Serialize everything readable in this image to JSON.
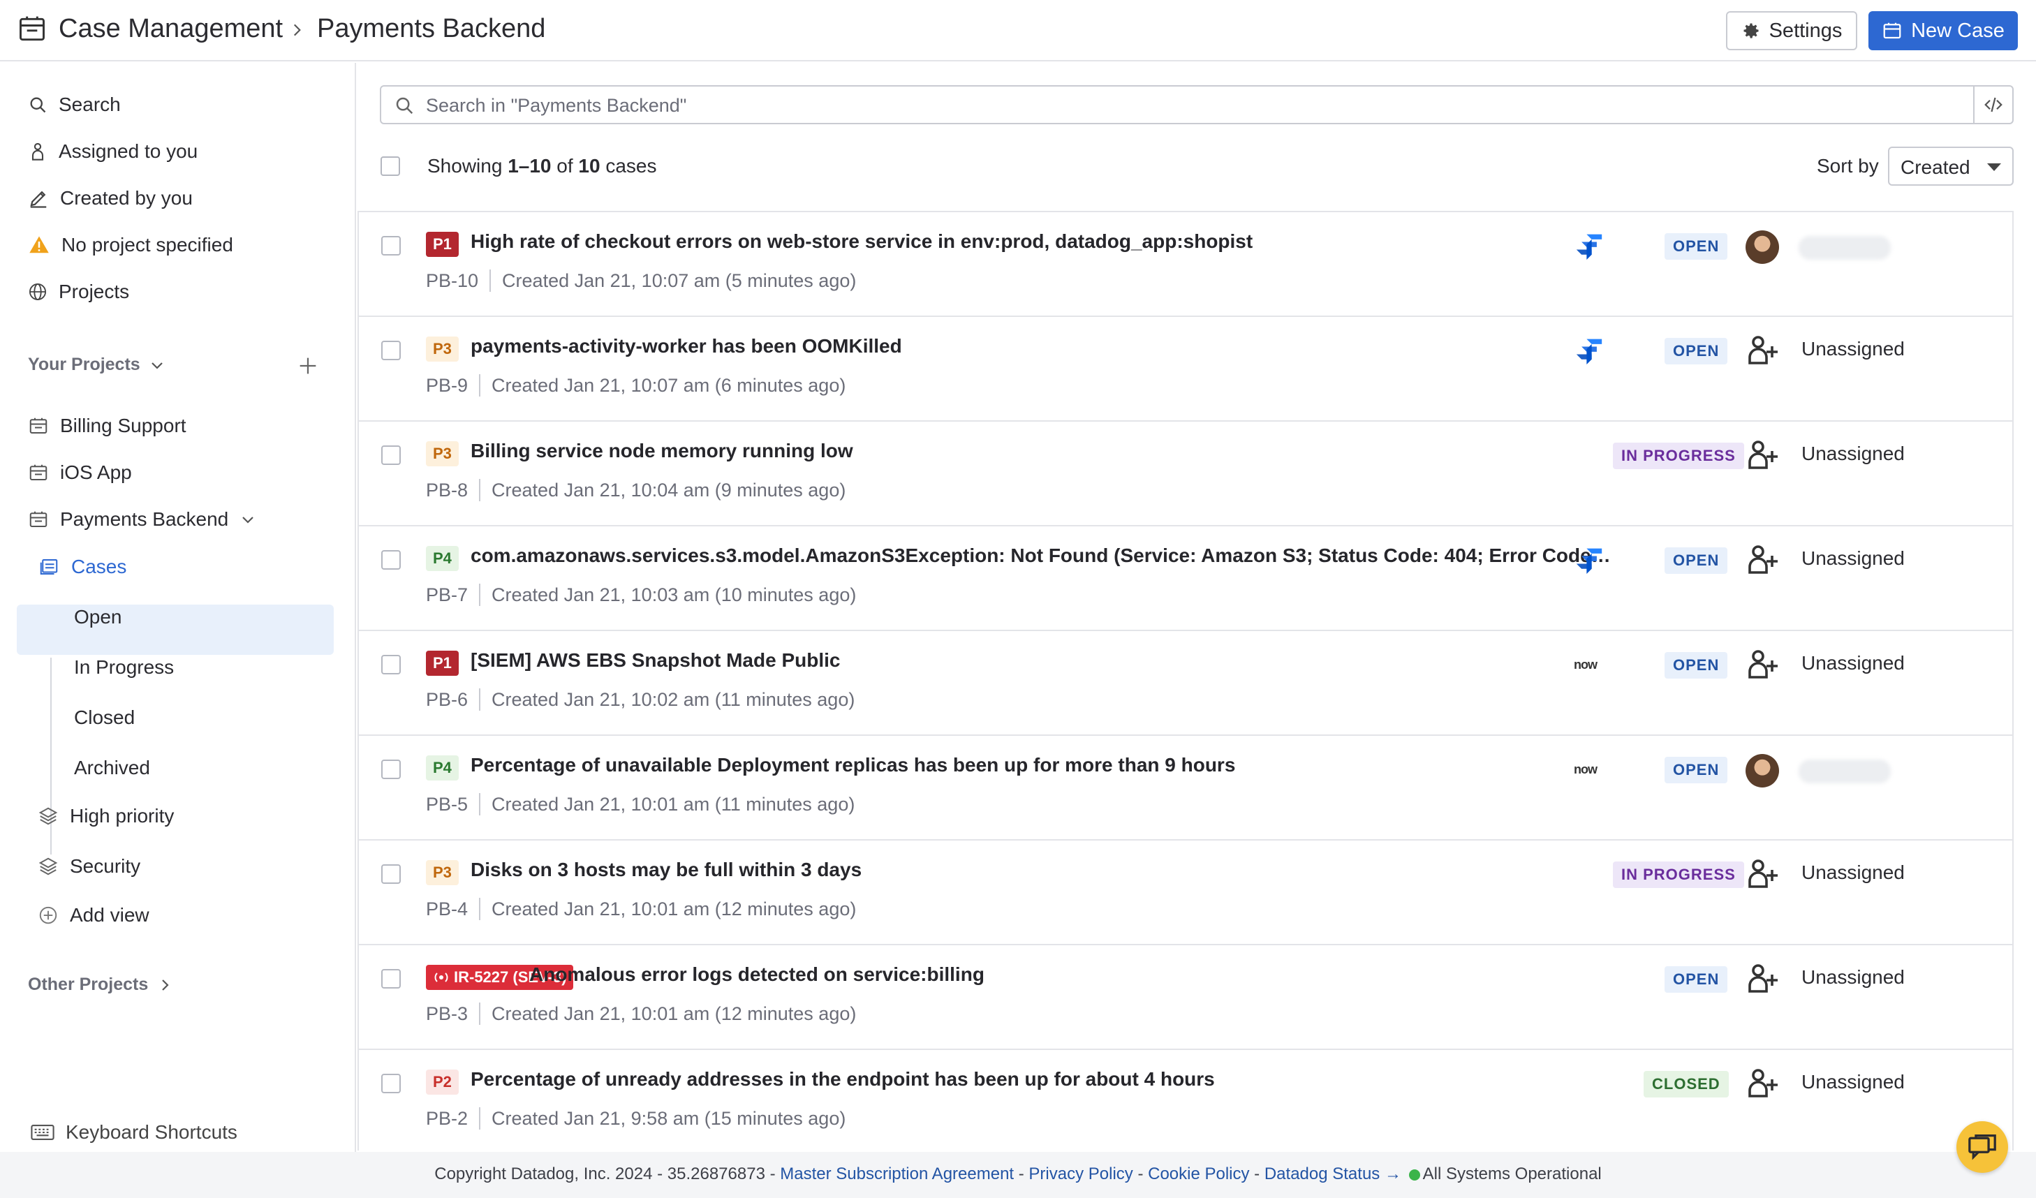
{
  "header": {
    "app_title": "Case Management",
    "page_title": "Payments Backend",
    "settings_label": "Settings",
    "new_case_label": "New Case"
  },
  "sidebar": {
    "nav": [
      {
        "label": "Search",
        "icon": "search-icon"
      },
      {
        "label": "Assigned to you",
        "icon": "person-icon"
      },
      {
        "label": "Created by you",
        "icon": "pencil-icon"
      },
      {
        "label": "No project specified",
        "icon": "warning-icon"
      },
      {
        "label": "Projects",
        "icon": "globe-icon"
      }
    ],
    "your_projects_label": "Your Projects",
    "projects": [
      {
        "label": "Billing Support"
      },
      {
        "label": "iOS App"
      },
      {
        "label": "Payments Backend"
      }
    ],
    "cases_label": "Cases",
    "case_views": [
      "Open",
      "In Progress",
      "Closed",
      "Archived"
    ],
    "extra_views": [
      {
        "label": "High priority",
        "icon": "layers-icon"
      },
      {
        "label": "Security",
        "icon": "layers-icon"
      }
    ],
    "add_view_label": "Add view",
    "other_projects_label": "Other Projects",
    "keyboard_shortcuts_label": "Keyboard Shortcuts"
  },
  "search": {
    "placeholder": "Search in \"Payments Backend\""
  },
  "list_header": {
    "showing_prefix": "Showing ",
    "showing_range": "1–10",
    "showing_mid": " of ",
    "showing_total": "10",
    "showing_suffix": " cases",
    "sort_label": "Sort by",
    "sort_value": "Created"
  },
  "cases": [
    {
      "priority": "P1",
      "title": "High rate of checkout errors on web-store service in env:prod, datadog_app:shopist",
      "id": "PB-10",
      "created": "Created Jan 21, 10:07 am (5 minutes ago)",
      "integration": "jira",
      "status": "OPEN",
      "assignee": ""
    },
    {
      "priority": "P3",
      "title": "payments-activity-worker has been OOMKilled",
      "id": "PB-9",
      "created": "Created Jan 21, 10:07 am (6 minutes ago)",
      "integration": "jira",
      "status": "OPEN",
      "assignee": "Unassigned"
    },
    {
      "priority": "P3",
      "title": "Billing service node memory running low",
      "id": "PB-8",
      "created": "Created Jan 21, 10:04 am (9 minutes ago)",
      "integration": "",
      "status": "IN PROGRESS",
      "assignee": "Unassigned"
    },
    {
      "priority": "P4",
      "title": "com.amazonaws.services.s3.model.AmazonS3Exception: Not Found (Service: Amazon S3; Status Code: 404; Error Code: NoSuchKey)",
      "id": "PB-7",
      "created": "Created Jan 21, 10:03 am (10 minutes ago)",
      "integration": "jira",
      "status": "OPEN",
      "assignee": "Unassigned"
    },
    {
      "priority": "P1",
      "title": "[SIEM] AWS EBS Snapshot Made Public",
      "id": "PB-6",
      "created": "Created Jan 21, 10:02 am (11 minutes ago)",
      "integration": "now",
      "status": "OPEN",
      "assignee": "Unassigned"
    },
    {
      "priority": "P4",
      "title": "Percentage of unavailable Deployment replicas has been up for more than 9 hours",
      "id": "PB-5",
      "created": "Created Jan 21, 10:01 am (11 minutes ago)",
      "integration": "now",
      "status": "OPEN",
      "assignee": ""
    },
    {
      "priority": "P3",
      "title": "Disks on 3 hosts may be full within 3 days",
      "id": "PB-4",
      "created": "Created Jan 21, 10:01 am (12 minutes ago)",
      "integration": "",
      "status": "IN PROGRESS",
      "assignee": "Unassigned"
    },
    {
      "priority": "IR-5227 (SEV-3)",
      "title": "Anomalous error logs detected on service:billing",
      "id": "PB-3",
      "created": "Created Jan 21, 10:01 am (12 minutes ago)",
      "integration": "",
      "status": "OPEN",
      "assignee": "Unassigned"
    },
    {
      "priority": "P2",
      "title": "Percentage of unready addresses in the endpoint has been up for about 4 hours",
      "id": "PB-2",
      "created": "Created Jan 21, 9:58 am (15 minutes ago)",
      "integration": "",
      "status": "CLOSED",
      "assignee": "Unassigned"
    }
  ],
  "integration_labels": {
    "now": "now"
  },
  "footer": {
    "copyright": "Copyright Datadog, Inc. 2024 - 35.26876873 - ",
    "links": [
      "Master Subscription Agreement",
      "Privacy Policy",
      "Cookie Policy",
      "Datadog Status →"
    ],
    "status_text": "All Systems Operational"
  },
  "colors": {
    "accent": "#2d68d2",
    "p1": "#b3272f",
    "status_open": "#2354a4",
    "status_in_progress": "#6a2d9c",
    "status_closed": "#2d6e31",
    "operational": "#3bb44a"
  }
}
